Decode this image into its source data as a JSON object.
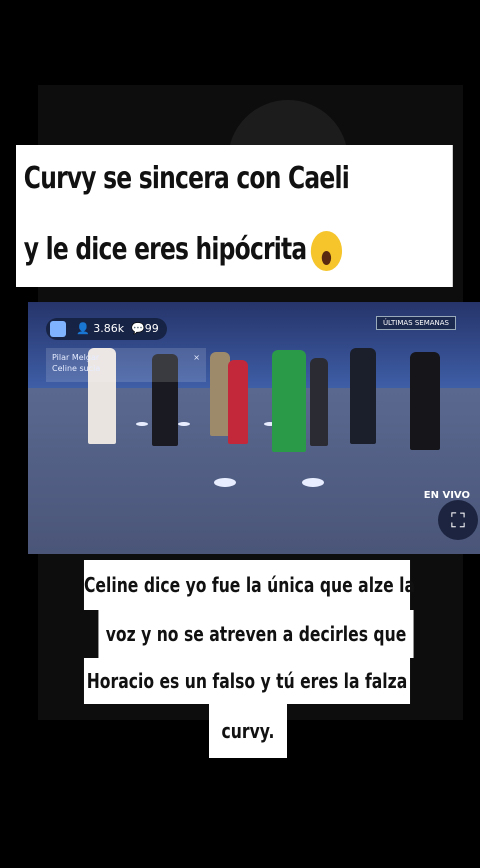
{
  "title": {
    "line1": "Curvy se sincera con Caeli",
    "line2": "y le dice eres hipócrita"
  },
  "video": {
    "viewers": "3.86k",
    "comments_count": "99",
    "comment_user": "Pilar Melgar",
    "comment_text": "Celine sucia",
    "close_glyph": "×",
    "badge": "ÚLTIMAS SEMANAS",
    "live_text": "EN VIVO",
    "fullscreen_glyph": "⛶"
  },
  "caption": {
    "line1": "Celine dice yo fue la única que alze la",
    "line2": "voz  y no se  atreven a decirles que",
    "line3": "Horacio es un falso y tú eres la falza",
    "line4": "curvy."
  }
}
